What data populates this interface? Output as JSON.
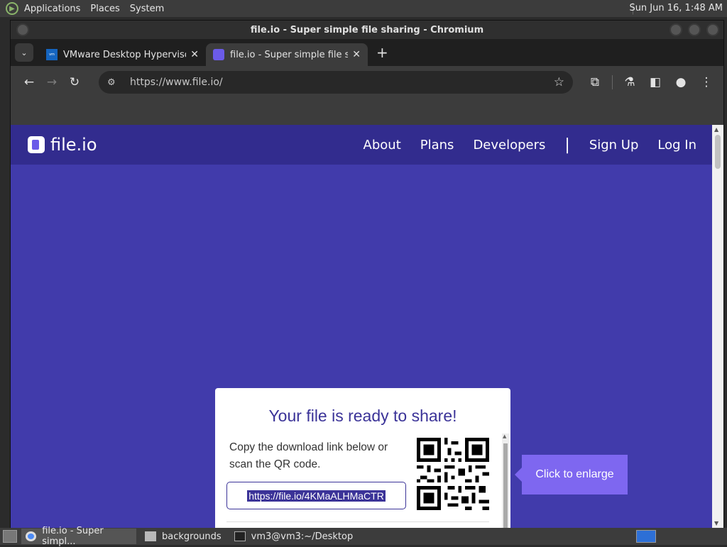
{
  "panel": {
    "menus": [
      "Applications",
      "Places",
      "System"
    ],
    "clock": "Sun Jun 16,  1:48 AM"
  },
  "window": {
    "title": "file.io - Super simple file sharing - Chromium"
  },
  "tabs": [
    {
      "title": "VMware Desktop Hypervisor",
      "active": false
    },
    {
      "title": "file.io - Super simple file sha",
      "active": true
    }
  ],
  "toolbar": {
    "url": "https://www.file.io/"
  },
  "site": {
    "brand": "file.io",
    "nav": [
      "About",
      "Plans",
      "Developers",
      "Sign Up",
      "Log In"
    ]
  },
  "card": {
    "heading": "Your file is ready to share!",
    "instruction": "Copy the download link below or scan the QR code.",
    "link": "https://file.io/4KMaALHMaCTR"
  },
  "tooltip": {
    "text": "Click to enlarge"
  },
  "taskbar": {
    "tasks": [
      "file.io - Super simpl...",
      "backgrounds",
      "vm3@vm3:~/Desktop"
    ]
  },
  "colors": {
    "page_bg": "#413bab",
    "header_bg": "#322c8e",
    "accent": "#3b3398",
    "tooltip_bg": "#7e67f0"
  }
}
